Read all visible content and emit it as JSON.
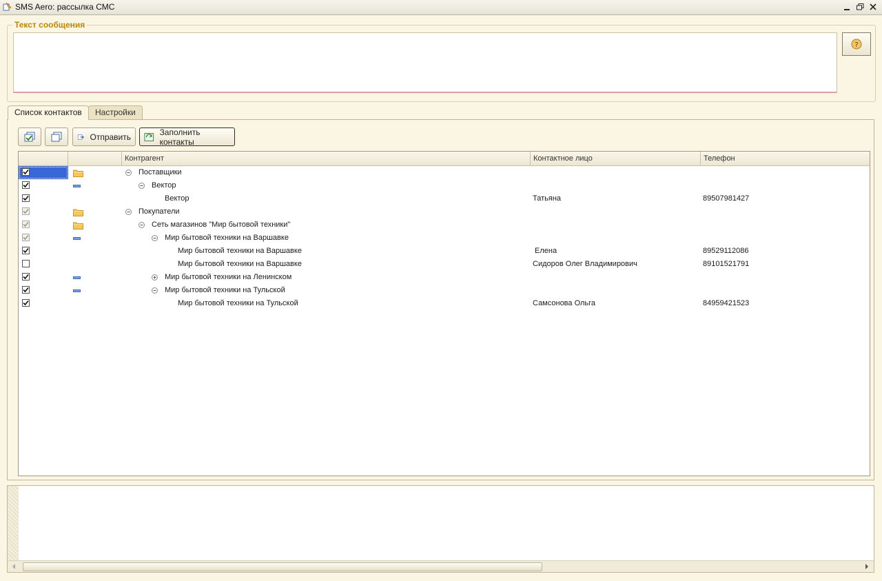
{
  "window": {
    "title": "SMS Aero: рассылка СМС"
  },
  "message": {
    "legend": "Текст сообщения",
    "text": ""
  },
  "tabs": [
    {
      "label": "Список контактов",
      "active": true
    },
    {
      "label": "Настройки",
      "active": false
    }
  ],
  "toolbar": {
    "check_all_icon": "check-all-icon",
    "uncheck_all_icon": "uncheck-all-icon",
    "send_label": "Отправить",
    "fill_label": "Заполнить контакты"
  },
  "table": {
    "columns": [
      "Контрагент",
      "Контактное лицо",
      "Телефон"
    ],
    "rows": [
      {
        "checked": true,
        "disabled": false,
        "icon": "folder",
        "level": 0,
        "expander": "minus",
        "name": "Поставщики",
        "contact": "",
        "phone": "",
        "selected": true
      },
      {
        "checked": true,
        "disabled": false,
        "icon": "item",
        "level": 1,
        "expander": "minus",
        "name": "Вектор",
        "contact": "",
        "phone": ""
      },
      {
        "checked": true,
        "disabled": false,
        "icon": "",
        "level": 2,
        "expander": "",
        "name": "Вектор",
        "contact": "Татьяна",
        "phone": "89507981427"
      },
      {
        "checked": true,
        "disabled": true,
        "icon": "folder",
        "level": 0,
        "expander": "minus",
        "name": "Покупатели",
        "contact": "",
        "phone": ""
      },
      {
        "checked": true,
        "disabled": true,
        "icon": "folder",
        "level": 1,
        "expander": "minus",
        "name": "Сеть магазинов \"Мир бытовой техники\"",
        "contact": "",
        "phone": ""
      },
      {
        "checked": true,
        "disabled": true,
        "icon": "item",
        "level": 2,
        "expander": "minus",
        "name": "Мир бытовой техники на Варшавке",
        "contact": "",
        "phone": ""
      },
      {
        "checked": true,
        "disabled": false,
        "icon": "",
        "level": 3,
        "expander": "",
        "name": "Мир бытовой техники на Варшавке",
        "contact": " Елена",
        "phone": "89529112086"
      },
      {
        "checked": false,
        "disabled": false,
        "icon": "",
        "level": 3,
        "expander": "",
        "name": "Мир бытовой техники на Варшавке",
        "contact": "Сидоров Олег Владимирович",
        "phone": "89101521791"
      },
      {
        "checked": true,
        "disabled": false,
        "icon": "item",
        "level": 2,
        "expander": "plus",
        "name": "Мир бытовой техники на Ленинском",
        "contact": "",
        "phone": ""
      },
      {
        "checked": true,
        "disabled": false,
        "icon": "item",
        "level": 2,
        "expander": "minus",
        "name": "Мир бытовой техники на Тульской",
        "contact": "",
        "phone": ""
      },
      {
        "checked": true,
        "disabled": false,
        "icon": "",
        "level": 3,
        "expander": "",
        "name": "Мир бытовой техники на Тульской",
        "contact": "Самсонова Ольга",
        "phone": "84959421523"
      }
    ]
  },
  "log": {
    "text": ""
  },
  "colors": {
    "accent": "#b8860b",
    "selection": "#3a67d6",
    "folder": "#f2c75c",
    "background": "#fbf5e3"
  }
}
